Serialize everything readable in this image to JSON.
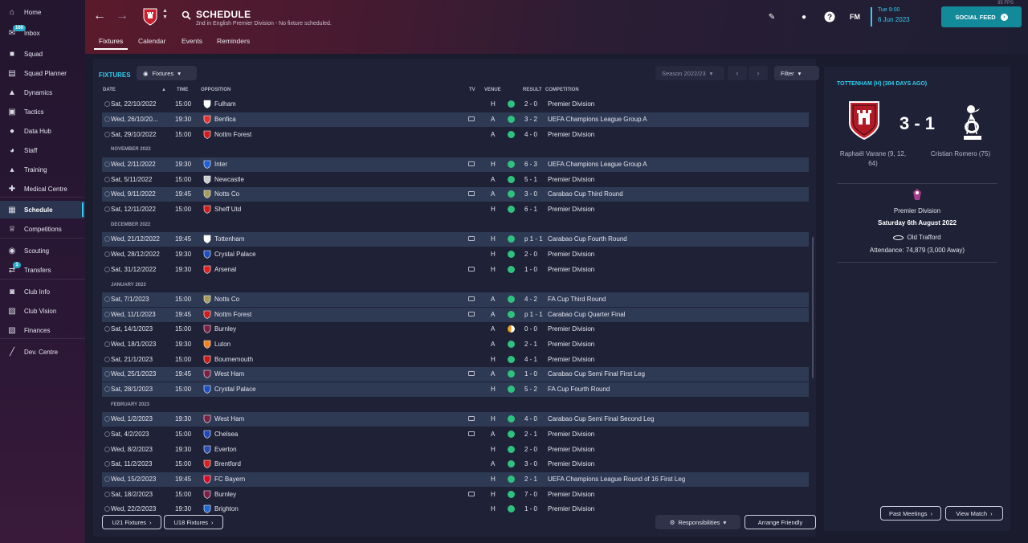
{
  "fps": "35 FPS",
  "sidebar": {
    "items": [
      {
        "label": "Home",
        "icon": "home-icon"
      },
      {
        "label": "Inbox",
        "icon": "inbox-icon",
        "badge": "160"
      },
      {
        "label": "Squad",
        "icon": "shirt-icon"
      },
      {
        "label": "Squad Planner",
        "icon": "planner-icon"
      },
      {
        "label": "Dynamics",
        "icon": "dynamics-icon"
      },
      {
        "label": "Tactics",
        "icon": "tactics-icon"
      },
      {
        "label": "Data Hub",
        "icon": "data-hub-icon"
      },
      {
        "label": "Staff",
        "icon": "staff-icon"
      },
      {
        "label": "Training",
        "icon": "training-icon"
      },
      {
        "label": "Medical Centre",
        "icon": "medical-icon"
      },
      {
        "label": "Schedule",
        "icon": "calendar-icon",
        "active": true
      },
      {
        "label": "Competitions",
        "icon": "trophy-icon"
      },
      {
        "label": "Scouting",
        "icon": "scouting-icon"
      },
      {
        "label": "Transfers",
        "icon": "transfers-icon",
        "badge": "1"
      },
      {
        "label": "Club Info",
        "icon": "club-info-icon"
      },
      {
        "label": "Club Vision",
        "icon": "club-vision-icon"
      },
      {
        "label": "Finances",
        "icon": "finances-icon"
      },
      {
        "label": "Dev. Centre",
        "icon": "dev-centre-icon"
      }
    ]
  },
  "header": {
    "title": "SCHEDULE",
    "subtitle": "2nd in English Premier Division - No fixture scheduled.",
    "tabs": [
      "Fixtures",
      "Calendar",
      "Events",
      "Reminders"
    ],
    "active_tab": "Fixtures",
    "fm_logo": "FM",
    "date_line1": "Tue 9:00",
    "date_line2": "6 Jun 2023",
    "social_feed": "SOCIAL FEED",
    "colors": {
      "accent": "#2fd0f0",
      "social": "#138a9a",
      "header_red": "#5a1a2c"
    }
  },
  "fixtures_panel": {
    "title": "FIXTURES",
    "view_dropdown": "Fixtures",
    "season": "Season 2022/23",
    "filter": "Filter",
    "columns": [
      "DATE",
      "TIME",
      "OPPOSITION",
      "TV",
      "VENUE",
      "RESULT",
      "COMPETITION"
    ],
    "months": {
      "nov": "NOVEMBER 2022",
      "dec": "DECEMBER 2022",
      "jan": "JANUARY 2023",
      "feb": "FEBRUARY 2023"
    },
    "rows": [
      {
        "date": "Sat, 22/10/2022",
        "time": "15:00",
        "opp": "Fulham",
        "tv": false,
        "venue": "H",
        "result": "2 - 0",
        "comp": "Premier Division",
        "shade": false,
        "color": "#ffffff"
      },
      {
        "date": "Wed, 26/10/20...",
        "time": "19:30",
        "opp": "Benfica",
        "tv": true,
        "venue": "A",
        "result": "3 - 2",
        "comp": "UEFA Champions League Group A",
        "shade": true,
        "color": "#e53030"
      },
      {
        "date": "Sat, 29/10/2022",
        "time": "15:00",
        "opp": "Nottm Forest",
        "tv": false,
        "venue": "A",
        "result": "4 - 0",
        "comp": "Premier Division",
        "shade": false,
        "color": "#d01c1c"
      },
      {
        "date": "Wed, 2/11/2022",
        "time": "19:30",
        "opp": "Inter",
        "tv": true,
        "venue": "H",
        "result": "6 - 3",
        "comp": "UEFA Champions League Group A",
        "shade": true,
        "color": "#1e5ed8"
      },
      {
        "date": "Sat, 5/11/2022",
        "time": "15:00",
        "opp": "Newcastle",
        "tv": false,
        "venue": "A",
        "result": "5 - 1",
        "comp": "Premier Division",
        "shade": false,
        "color": "#cccccc"
      },
      {
        "date": "Wed, 9/11/2022",
        "time": "19:45",
        "opp": "Notts Co",
        "tv": true,
        "venue": "A",
        "result": "3 - 0",
        "comp": "Carabao Cup Third Round",
        "shade": true,
        "color": "#a89a5a"
      },
      {
        "date": "Sat, 12/11/2022",
        "time": "15:00",
        "opp": "Sheff Utd",
        "tv": false,
        "venue": "H",
        "result": "6 - 1",
        "comp": "Premier Division",
        "shade": false,
        "color": "#d01c1c"
      },
      {
        "date": "Wed, 21/12/2022",
        "time": "19:45",
        "opp": "Tottenham",
        "tv": true,
        "venue": "H",
        "result": "p 1 - 1",
        "comp": "Carabao Cup Fourth Round",
        "shade": true,
        "color": "#ffffff"
      },
      {
        "date": "Wed, 28/12/2022",
        "time": "19:30",
        "opp": "Crystal Palace",
        "tv": false,
        "venue": "H",
        "result": "2 - 0",
        "comp": "Premier Division",
        "shade": false,
        "color": "#1b4fc2"
      },
      {
        "date": "Sat, 31/12/2022",
        "time": "19:30",
        "opp": "Arsenal",
        "tv": true,
        "venue": "H",
        "result": "1 - 0",
        "comp": "Premier Division",
        "shade": false,
        "color": "#e02020"
      },
      {
        "date": "Sat, 7/1/2023",
        "time": "15:00",
        "opp": "Notts Co",
        "tv": true,
        "venue": "A",
        "result": "4 - 2",
        "comp": "FA Cup Third Round",
        "shade": true,
        "color": "#a89a5a"
      },
      {
        "date": "Wed, 11/1/2023",
        "time": "19:45",
        "opp": "Nottm Forest",
        "tv": true,
        "venue": "A",
        "result": "p 1 - 1",
        "comp": "Carabao Cup Quarter Final",
        "shade": true,
        "color": "#d01c1c"
      },
      {
        "date": "Sat, 14/1/2023",
        "time": "15:00",
        "opp": "Burnley",
        "tv": false,
        "venue": "A",
        "result": "0 - 0",
        "comp": "Premier Division",
        "shade": false,
        "color": "#7a2044",
        "draw": true
      },
      {
        "date": "Wed, 18/1/2023",
        "time": "19:30",
        "opp": "Luton",
        "tv": false,
        "venue": "A",
        "result": "2 - 1",
        "comp": "Premier Division",
        "shade": false,
        "color": "#f08020"
      },
      {
        "date": "Sat, 21/1/2023",
        "time": "15:00",
        "opp": "Bournemouth",
        "tv": false,
        "venue": "H",
        "result": "4 - 1",
        "comp": "Premier Division",
        "shade": false,
        "color": "#c81818"
      },
      {
        "date": "Wed, 25/1/2023",
        "time": "19:45",
        "opp": "West Ham",
        "tv": true,
        "venue": "A",
        "result": "1 - 0",
        "comp": "Carabao Cup Semi Final First Leg",
        "shade": true,
        "color": "#7a2040"
      },
      {
        "date": "Sat, 28/1/2023",
        "time": "15:00",
        "opp": "Crystal Palace",
        "tv": false,
        "venue": "H",
        "result": "5 - 2",
        "comp": "FA Cup Fourth Round",
        "shade": true,
        "color": "#1b4fc2"
      },
      {
        "date": "Wed, 1/2/2023",
        "time": "19:30",
        "opp": "West Ham",
        "tv": true,
        "venue": "H",
        "result": "4 - 0",
        "comp": "Carabao Cup Semi Final Second Leg",
        "shade": true,
        "color": "#7a2040"
      },
      {
        "date": "Sat, 4/2/2023",
        "time": "15:00",
        "opp": "Chelsea",
        "tv": true,
        "venue": "A",
        "result": "2 - 1",
        "comp": "Premier Division",
        "shade": false,
        "color": "#1f48b8"
      },
      {
        "date": "Wed, 8/2/2023",
        "time": "19:30",
        "opp": "Everton",
        "tv": false,
        "venue": "H",
        "result": "2 - 0",
        "comp": "Premier Division",
        "shade": false,
        "color": "#2a4fb0"
      },
      {
        "date": "Sat, 11/2/2023",
        "time": "15:00",
        "opp": "Brentford",
        "tv": false,
        "venue": "A",
        "result": "3 - 0",
        "comp": "Premier Division",
        "shade": false,
        "color": "#d82020"
      },
      {
        "date": "Wed, 15/2/2023",
        "time": "19:45",
        "opp": "FC Bayern",
        "tv": false,
        "venue": "H",
        "result": "2 - 1",
        "comp": "UEFA Champions League Round of 16  First Leg",
        "shade": true,
        "color": "#d80a2a"
      },
      {
        "date": "Sat, 18/2/2023",
        "time": "15:00",
        "opp": "Burnley",
        "tv": true,
        "venue": "H",
        "result": "7 - 0",
        "comp": "Premier Division",
        "shade": false,
        "color": "#7a2044"
      },
      {
        "date": "Wed, 22/2/2023",
        "time": "19:30",
        "opp": "Brighton",
        "tv": false,
        "venue": "H",
        "result": "1 - 0",
        "comp": "Premier Division",
        "shade": false,
        "color": "#1f6ad0"
      }
    ],
    "buttons": {
      "u21": "U21 Fixtures",
      "u18": "U18 Fixtures",
      "responsibilities": "Responsibilities",
      "arrange": "Arrange Friendly"
    }
  },
  "match_panel": {
    "title": "TOTTENHAM (H) (304 DAYS AGO)",
    "score": "3 - 1",
    "home_scorers": "Raphaël Varane (9, 12, 64)",
    "away_scorer": "Cristian Romero (75)",
    "competition": "Premier Division",
    "date": "Saturday 6th August 2022",
    "stadium": "Old Trafford",
    "attendance": "Attendance: 74,879 (3,000 Away)",
    "past_meetings": "Past Meetings",
    "view_match": "View Match"
  }
}
